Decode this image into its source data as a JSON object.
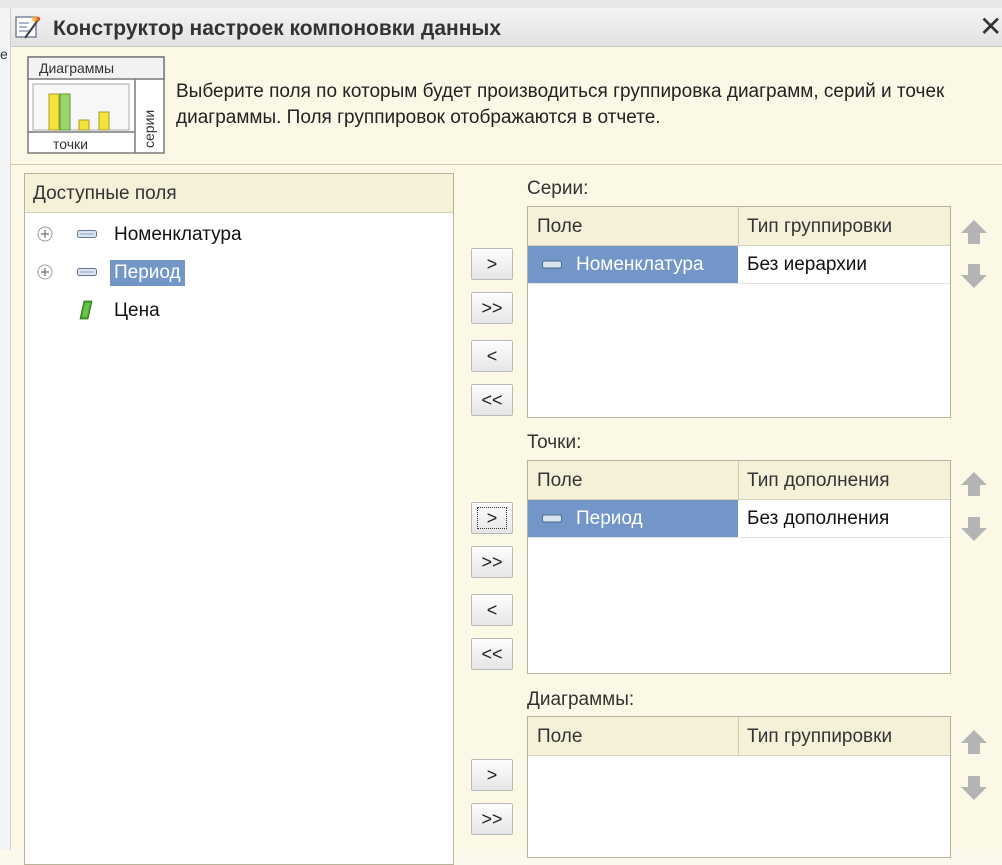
{
  "window": {
    "title": "Конструктор настроек компоновки данных",
    "close_label": "✕"
  },
  "background": {
    "edge_text": "е"
  },
  "illustration": {
    "title": "Диаграммы",
    "bottom_label": "точки",
    "side_label": "серии"
  },
  "hint_text": "Выберите поля по которым будет производиться группировка диаграмм, серий и точек диаграммы. Поля группировок отображаются в отчете.",
  "available": {
    "title": "Доступные поля",
    "items": [
      {
        "label": "Номенклатура"
      },
      {
        "label": "Период"
      },
      {
        "label": "Цена"
      }
    ]
  },
  "buttons": {
    "add": ">",
    "add_all": ">>",
    "remove": "<",
    "remove_all": "<<"
  },
  "series": {
    "label": "Серии:",
    "col1": "Поле",
    "col2": "Тип группировки",
    "rows": [
      {
        "field": "Номенклатура",
        "type": "Без иерархии"
      }
    ]
  },
  "points": {
    "label": "Точки:",
    "col1": "Поле",
    "col2": "Тип дополнения",
    "rows": [
      {
        "field": "Период",
        "type": "Без дополнения"
      }
    ]
  },
  "charts": {
    "label": "Диаграммы:",
    "col1": "Поле",
    "col2": "Тип группировки",
    "rows": []
  },
  "colors": {
    "selection": "#7396c9",
    "panel_bg": "#fbf8e6",
    "header_bg": "#f5f1d8",
    "arrow_gray": "#b4b4b4",
    "field_icon_green": "#3fa02a"
  }
}
